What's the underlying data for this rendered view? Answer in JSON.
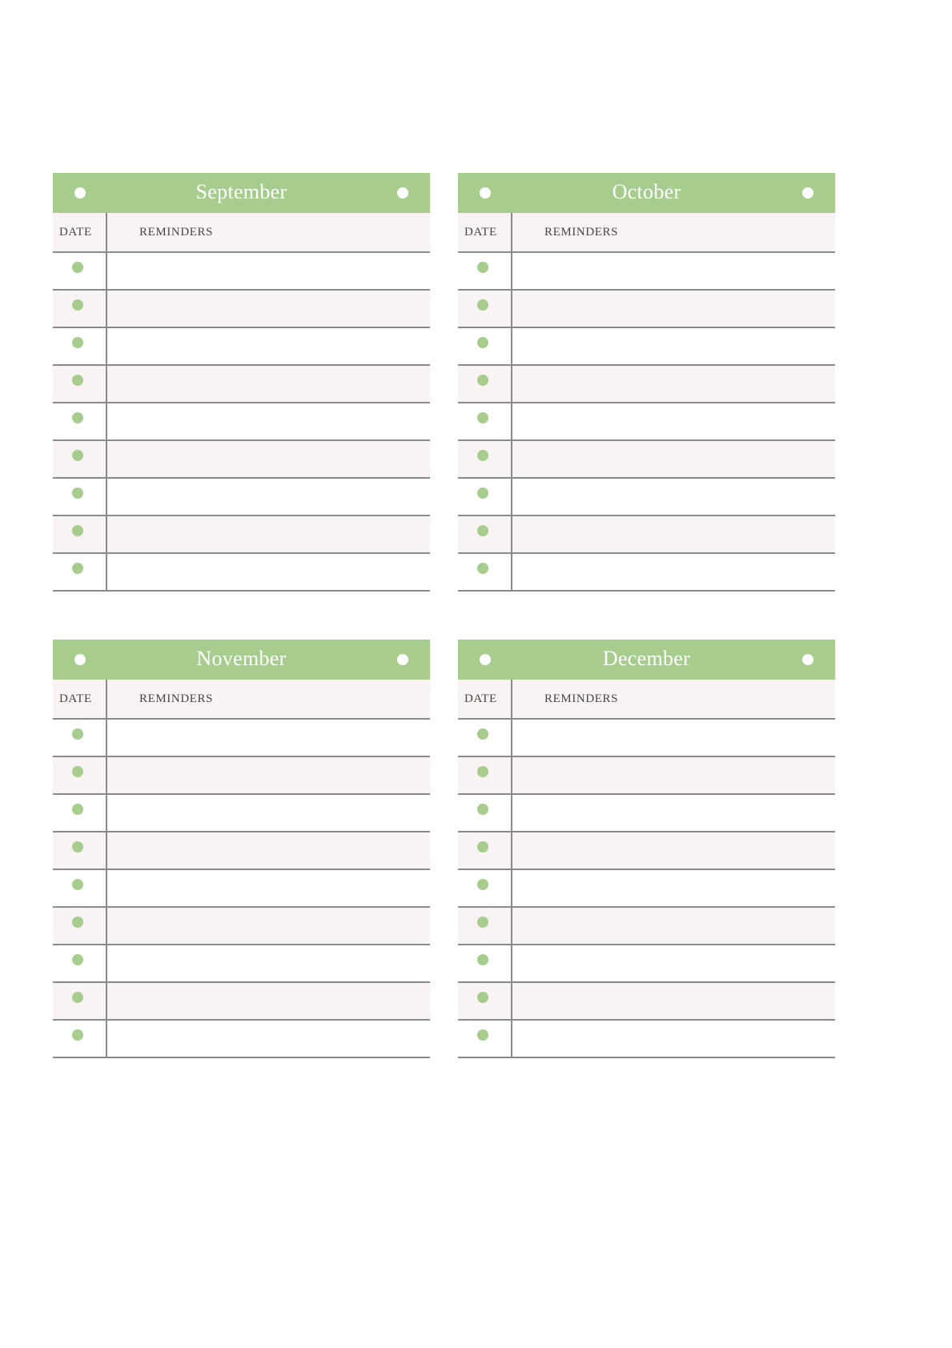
{
  "page": {
    "background_color": "#ffffff",
    "accent_green": "#a6cc8e",
    "row_alt_color": "#faf3f3",
    "rule_color": "#8a8a8a",
    "text_color": "#4a4340"
  },
  "columns": {
    "date_label": "DATE",
    "reminders_label": "REMINDERS"
  },
  "months": [
    {
      "name": "September",
      "row_count": 9,
      "rows": [
        {
          "date": "",
          "reminder": ""
        },
        {
          "date": "",
          "reminder": ""
        },
        {
          "date": "",
          "reminder": ""
        },
        {
          "date": "",
          "reminder": ""
        },
        {
          "date": "",
          "reminder": ""
        },
        {
          "date": "",
          "reminder": ""
        },
        {
          "date": "",
          "reminder": ""
        },
        {
          "date": "",
          "reminder": ""
        },
        {
          "date": "",
          "reminder": ""
        }
      ]
    },
    {
      "name": "October",
      "row_count": 9,
      "rows": [
        {
          "date": "",
          "reminder": ""
        },
        {
          "date": "",
          "reminder": ""
        },
        {
          "date": "",
          "reminder": ""
        },
        {
          "date": "",
          "reminder": ""
        },
        {
          "date": "",
          "reminder": ""
        },
        {
          "date": "",
          "reminder": ""
        },
        {
          "date": "",
          "reminder": ""
        },
        {
          "date": "",
          "reminder": ""
        },
        {
          "date": "",
          "reminder": ""
        }
      ]
    },
    {
      "name": "November",
      "row_count": 9,
      "rows": [
        {
          "date": "",
          "reminder": ""
        },
        {
          "date": "",
          "reminder": ""
        },
        {
          "date": "",
          "reminder": ""
        },
        {
          "date": "",
          "reminder": ""
        },
        {
          "date": "",
          "reminder": ""
        },
        {
          "date": "",
          "reminder": ""
        },
        {
          "date": "",
          "reminder": ""
        },
        {
          "date": "",
          "reminder": ""
        },
        {
          "date": "",
          "reminder": ""
        }
      ]
    },
    {
      "name": "December",
      "row_count": 9,
      "rows": [
        {
          "date": "",
          "reminder": ""
        },
        {
          "date": "",
          "reminder": ""
        },
        {
          "date": "",
          "reminder": ""
        },
        {
          "date": "",
          "reminder": ""
        },
        {
          "date": "",
          "reminder": ""
        },
        {
          "date": "",
          "reminder": ""
        },
        {
          "date": "",
          "reminder": ""
        },
        {
          "date": "",
          "reminder": ""
        },
        {
          "date": "",
          "reminder": ""
        }
      ]
    }
  ]
}
